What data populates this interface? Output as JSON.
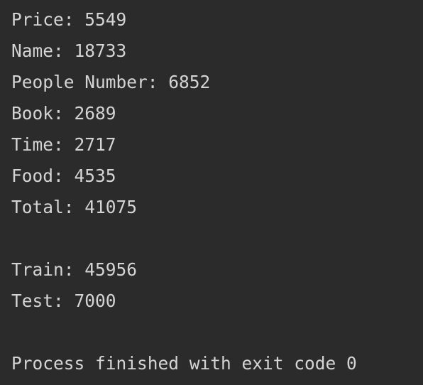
{
  "console": {
    "lines": [
      "Price: 5549",
      "Name: 18733",
      "People Number: 6852",
      "Book: 2689",
      "Time: 2717",
      "Food: 4535",
      "Total: 41075",
      "Train: 45956",
      "Test: 7000",
      "Process finished with exit code 0"
    ]
  },
  "colors": {
    "background": "#2b2b2b",
    "text": "#d4d4d4"
  }
}
